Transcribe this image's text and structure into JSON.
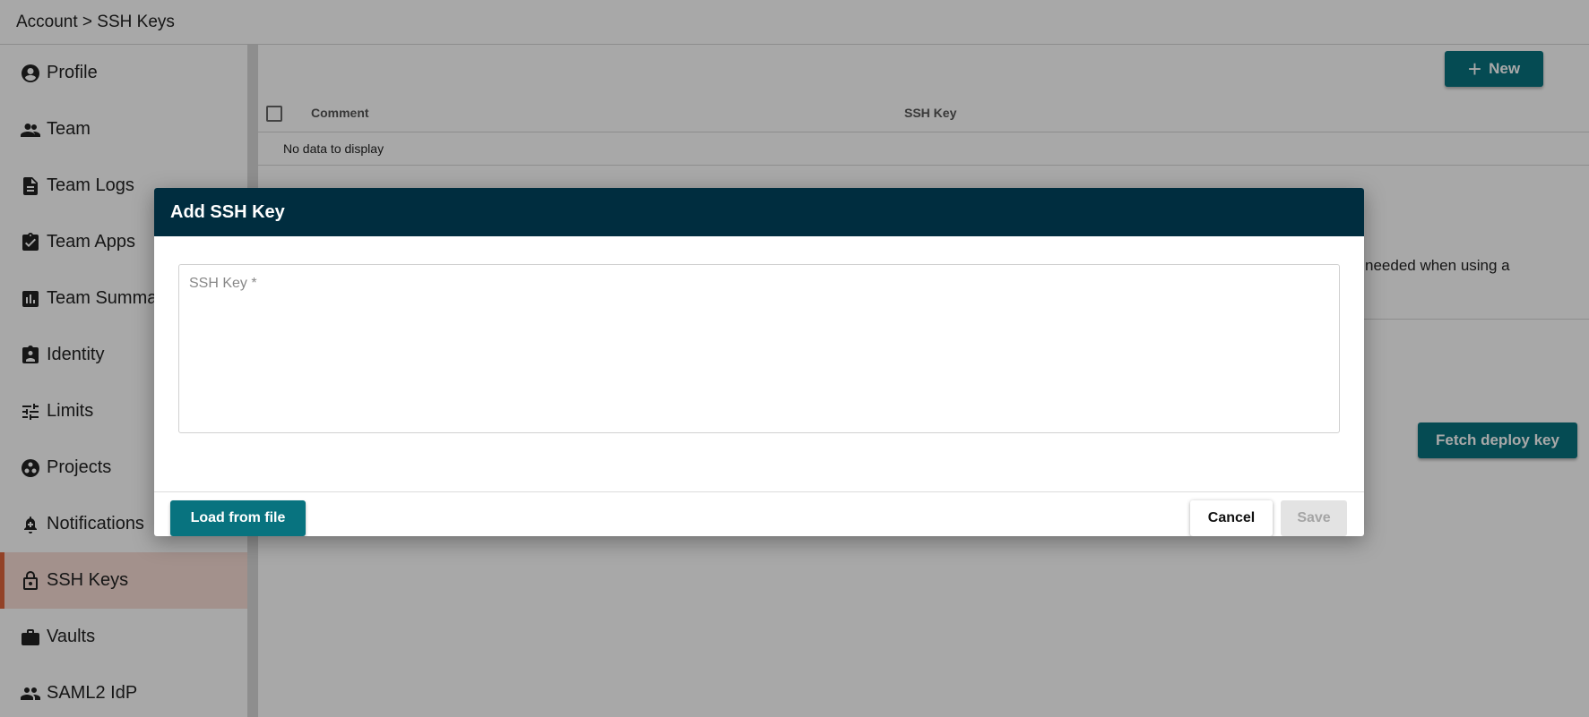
{
  "header": {
    "breadcrumb": "Account > SSH Keys"
  },
  "sidebar": {
    "items": [
      {
        "label": "Profile",
        "icon": "account-circle-icon"
      },
      {
        "label": "Team",
        "icon": "team-icon"
      },
      {
        "label": "Team Logs",
        "icon": "document-icon"
      },
      {
        "label": "Team Apps",
        "icon": "clipboard-check-icon"
      },
      {
        "label": "Team Summary",
        "icon": "bar-chart-icon"
      },
      {
        "label": "Identity",
        "icon": "identity-badge-icon"
      },
      {
        "label": "Limits",
        "icon": "sliders-icon"
      },
      {
        "label": "Projects",
        "icon": "projects-icon"
      },
      {
        "label": "Notifications",
        "icon": "bell-icon"
      },
      {
        "label": "SSH Keys",
        "icon": "lock-icon",
        "active": true
      },
      {
        "label": "Vaults",
        "icon": "briefcase-icon"
      },
      {
        "label": "SAML2 IdP",
        "icon": "people-icon"
      }
    ]
  },
  "main": {
    "new_label": "New",
    "columns": {
      "comment": "Comment",
      "ssh_key": "SSH Key"
    },
    "empty_text": "No data to display",
    "info_text": "needed when using a",
    "fetch_label": "Fetch deploy key"
  },
  "dialog": {
    "title": "Add SSH Key",
    "ssh_key_placeholder": "SSH Key *",
    "ssh_key_value": "",
    "load_label": "Load from file",
    "cancel_label": "Cancel",
    "save_label": "Save"
  },
  "colors": {
    "accent": "#08737f",
    "dialog_header": "#002d3f",
    "active_nav_bar": "#e0643c",
    "active_nav_bg": "#f7ddd5"
  }
}
